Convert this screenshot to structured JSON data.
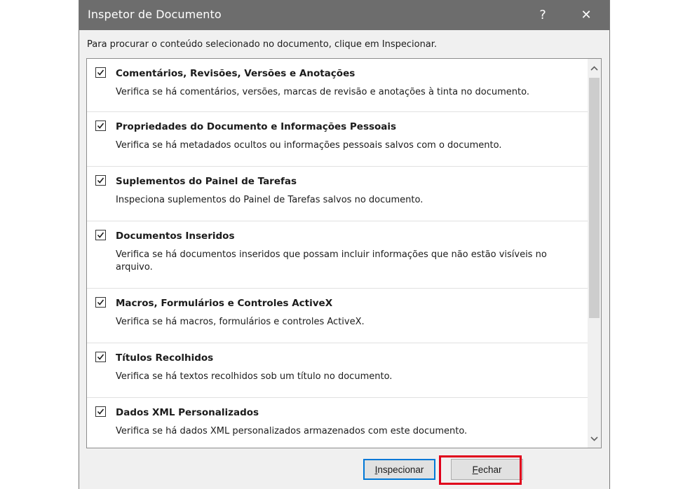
{
  "dialog": {
    "title": "Inspetor de Documento",
    "help_glyph": "?",
    "close_glyph": "✕",
    "instruction": "Para procurar o conteúdo selecionado no documento, clique em Inspecionar."
  },
  "items": [
    {
      "checked": true,
      "title": "Comentários, Revisões, Versões e Anotações",
      "description": "Verifica se há comentários, versões, marcas de revisão e anotações à tinta no documento."
    },
    {
      "checked": true,
      "title": "Propriedades do Documento e Informações Pessoais",
      "description": "Verifica se há metadados ocultos ou informações pessoais salvos com o documento."
    },
    {
      "checked": true,
      "title": "Suplementos do Painel de Tarefas",
      "description": "Inspeciona suplementos do Painel de Tarefas salvos no documento."
    },
    {
      "checked": true,
      "title": "Documentos Inseridos",
      "description": "Verifica se há documentos inseridos que possam incluir informações que não estão visíveis no arquivo."
    },
    {
      "checked": true,
      "title": "Macros, Formulários e Controles ActiveX",
      "description": "Verifica se há macros, formulários e controles ActiveX."
    },
    {
      "checked": true,
      "title": "Títulos Recolhidos",
      "description": "Verifica se há textos recolhidos sob um título no documento."
    },
    {
      "checked": true,
      "title": "Dados XML Personalizados",
      "description": "Verifica se há dados XML personalizados armazenados com este documento."
    }
  ],
  "buttons": {
    "inspect": {
      "accel": "I",
      "rest": "nspecionar"
    },
    "close": {
      "accel": "F",
      "rest": "echar"
    }
  },
  "colors": {
    "titlebar": "#6d6d6d",
    "highlight": "#e0001b",
    "focus": "#0078d7"
  }
}
